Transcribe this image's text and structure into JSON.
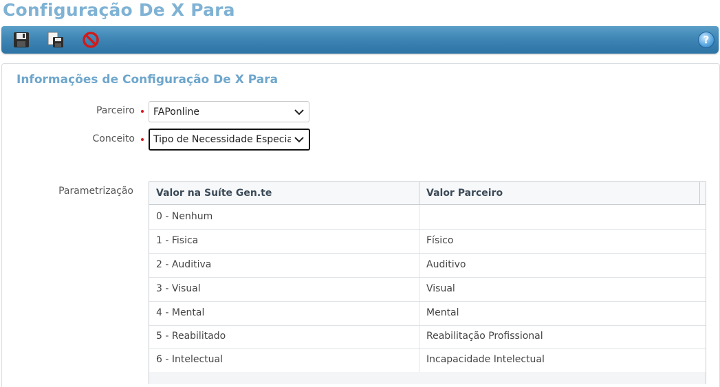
{
  "page": {
    "title": "Configuração De X Para"
  },
  "toolbar": {
    "buttons": [
      {
        "icon": "save-icon"
      },
      {
        "icon": "save-copy-icon"
      },
      {
        "icon": "cancel-icon"
      }
    ],
    "help_label": "?"
  },
  "panel": {
    "title": "Informações de Configuração De X Para"
  },
  "form": {
    "parceiro": {
      "label": "Parceiro",
      "value": "FAPonline"
    },
    "conceito": {
      "label": "Conceito",
      "value": "Tipo de Necessidade Especial"
    },
    "parametrizacao_label": "Parametrização"
  },
  "grid": {
    "headers": [
      "Valor na Suíte Gen.te",
      "Valor Parceiro"
    ],
    "rows": [
      [
        "0 - Nenhum",
        ""
      ],
      [
        "1 - Fisica",
        "Físico"
      ],
      [
        "2 - Auditiva",
        "Auditivo"
      ],
      [
        "3 - Visual",
        "Visual"
      ],
      [
        "4 - Mental",
        "Mental"
      ],
      [
        "5 - Reabilitado",
        "Reabilitação Profissional"
      ],
      [
        "6 - Intelectual",
        "Incapacidade Intelectual"
      ]
    ]
  },
  "colors": {
    "accent": "#7fb2d4",
    "toolbar": "#3f86b5",
    "required": "#d9181f"
  }
}
